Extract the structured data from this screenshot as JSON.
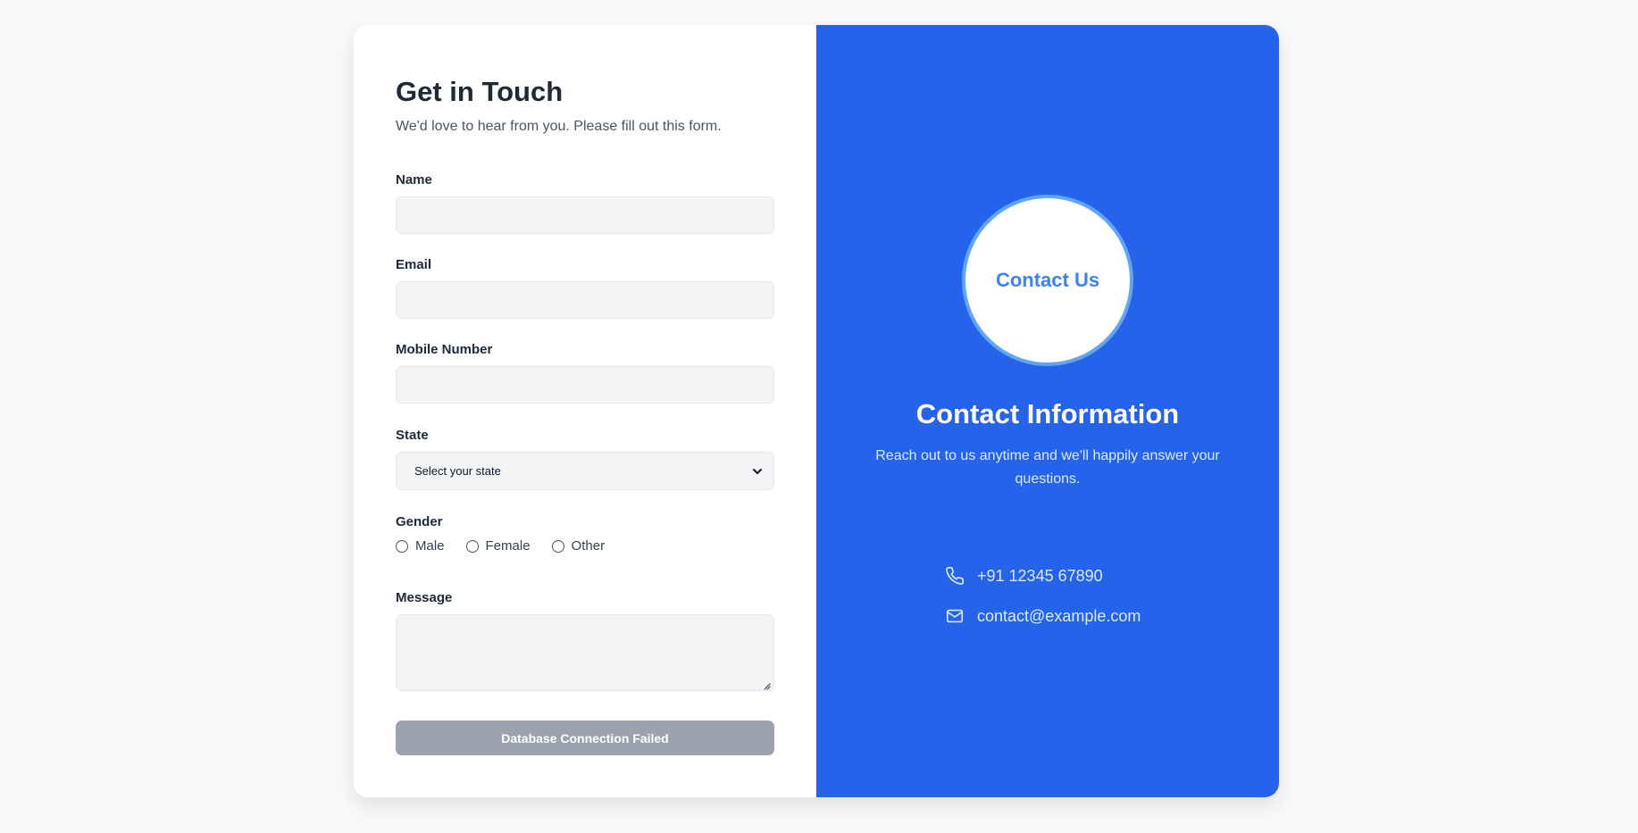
{
  "form": {
    "title": "Get in Touch",
    "subtitle": "We'd love to hear from you. Please fill out this form.",
    "name_label": "Name",
    "email_label": "Email",
    "mobile_label": "Mobile Number",
    "state_label": "State",
    "state_selected": "Select your state",
    "gender_label": "Gender",
    "gender_options": [
      "Male",
      "Female",
      "Other"
    ],
    "message_label": "Message",
    "submit_label": "Database Connection Failed"
  },
  "info": {
    "badge": "Contact Us",
    "title": "Contact Information",
    "subtitle": "Reach out to us anytime and we'll happily answer your questions.",
    "phone": "+91 12345 67890",
    "email": "contact@example.com",
    "phone_icon": "phone-icon",
    "email_icon": "mail-icon"
  },
  "colors": {
    "accent": "#2563eb",
    "badge_text": "#3b82f6",
    "badge_ring": "#60a5fa",
    "disabled_button": "#9ca3af"
  }
}
